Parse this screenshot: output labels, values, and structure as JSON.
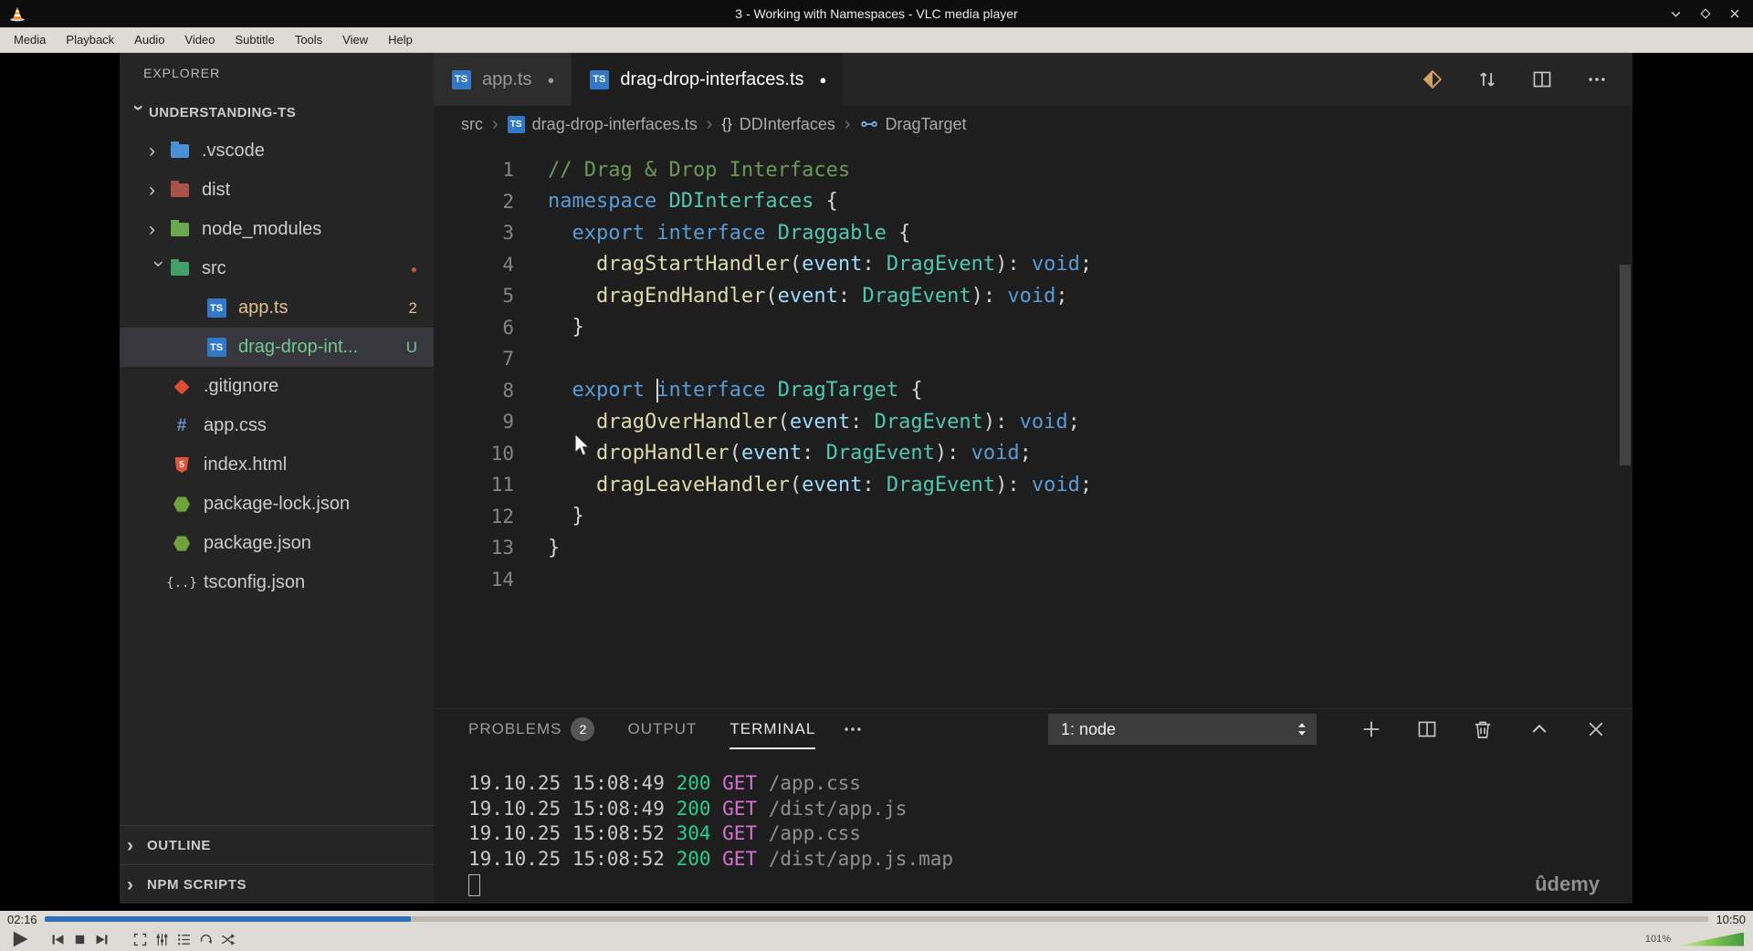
{
  "colors": {
    "accent_blue": "#2f6fb5",
    "keyword_blue": "#569cd6",
    "type_green": "#4ec9b0",
    "function_yellow": "#dcdcaa",
    "comment_green": "#6a9955",
    "param_blue": "#9cdcfe",
    "status_green": "#23d18b",
    "method_magenta": "#d670d6",
    "modified_tan": "#e2c08d",
    "untracked_green": "#73c991"
  },
  "vlc": {
    "window_title": "3 - Working with Namespaces - VLC media player",
    "menu_items": [
      "Media",
      "Playback",
      "Audio",
      "Video",
      "Subtitle",
      "Tools",
      "View",
      "Help"
    ],
    "seek": {
      "elapsed": "02:16",
      "remaining": "10:50",
      "progress_percent": 22
    },
    "volume_percent": "101%"
  },
  "vscode": {
    "explorer": {
      "title": "EXPLORER",
      "root_label": "UNDERSTANDING-TS",
      "tree": [
        {
          "label": ".vscode",
          "kind": "folder",
          "icon": "vscode-folder",
          "depth": 1,
          "chevron": "right"
        },
        {
          "label": "dist",
          "kind": "folder",
          "icon": "dist-folder",
          "depth": 1,
          "chevron": "right"
        },
        {
          "label": "node_modules",
          "kind": "folder",
          "icon": "node-folder",
          "depth": 1,
          "chevron": "right"
        },
        {
          "label": "src",
          "kind": "folder",
          "icon": "src-folder",
          "depth": 1,
          "chevron": "down",
          "badge": "dot"
        },
        {
          "label": "app.ts",
          "kind": "file",
          "icon": "ts",
          "depth": 2,
          "badge": "2",
          "color": "modified"
        },
        {
          "label": "drag-drop-int...",
          "kind": "file",
          "icon": "ts",
          "depth": 2,
          "badge": "U",
          "color": "untracked",
          "selected": true
        },
        {
          "label": ".gitignore",
          "kind": "file",
          "icon": "git",
          "depth": 1
        },
        {
          "label": "app.css",
          "kind": "file",
          "icon": "css",
          "depth": 1
        },
        {
          "label": "index.html",
          "kind": "file",
          "icon": "html",
          "depth": 1
        },
        {
          "label": "package-lock.json",
          "kind": "file",
          "icon": "npm",
          "depth": 1
        },
        {
          "label": "package.json",
          "kind": "file",
          "icon": "npm",
          "depth": 1
        },
        {
          "label": "tsconfig.json",
          "kind": "file",
          "icon": "json-config",
          "depth": 1
        }
      ],
      "bottom_sections": [
        "OUTLINE",
        "NPM SCRIPTS"
      ]
    },
    "editor_tabs": [
      {
        "label": "app.ts",
        "active": false,
        "modified": true
      },
      {
        "label": "drag-drop-interfaces.ts",
        "active": true,
        "modified": true
      }
    ],
    "breadcrumb": [
      {
        "label": "src",
        "icon": null
      },
      {
        "label": "drag-drop-interfaces.ts",
        "icon": "ts"
      },
      {
        "label": "DDInterfaces",
        "icon": "braces"
      },
      {
        "label": "DragTarget",
        "icon": "symbol"
      }
    ],
    "code_lines": [
      {
        "num": 1,
        "tokens": [
          {
            "c": "comment",
            "v": "// Drag & Drop Interfaces"
          }
        ]
      },
      {
        "num": 2,
        "tokens": [
          {
            "c": "kw",
            "v": "namespace"
          },
          {
            "c": "punct",
            "v": " "
          },
          {
            "c": "type",
            "v": "DDInterfaces"
          },
          {
            "c": "punct",
            "v": " {"
          }
        ]
      },
      {
        "num": 3,
        "tokens": [
          {
            "c": "punct",
            "v": "  "
          },
          {
            "c": "kw",
            "v": "export"
          },
          {
            "c": "punct",
            "v": " "
          },
          {
            "c": "kw",
            "v": "interface"
          },
          {
            "c": "punct",
            "v": " "
          },
          {
            "c": "type",
            "v": "Draggable"
          },
          {
            "c": "punct",
            "v": " {"
          }
        ]
      },
      {
        "num": 4,
        "tokens": [
          {
            "c": "punct",
            "v": "    "
          },
          {
            "c": "fn",
            "v": "dragStartHandler"
          },
          {
            "c": "punct",
            "v": "("
          },
          {
            "c": "param",
            "v": "event"
          },
          {
            "c": "punct",
            "v": ": "
          },
          {
            "c": "type",
            "v": "DragEvent"
          },
          {
            "c": "punct",
            "v": "): "
          },
          {
            "c": "kw",
            "v": "void"
          },
          {
            "c": "punct",
            "v": ";"
          }
        ]
      },
      {
        "num": 5,
        "tokens": [
          {
            "c": "punct",
            "v": "    "
          },
          {
            "c": "fn",
            "v": "dragEndHandler"
          },
          {
            "c": "punct",
            "v": "("
          },
          {
            "c": "param",
            "v": "event"
          },
          {
            "c": "punct",
            "v": ": "
          },
          {
            "c": "type",
            "v": "DragEvent"
          },
          {
            "c": "punct",
            "v": "): "
          },
          {
            "c": "kw",
            "v": "void"
          },
          {
            "c": "punct",
            "v": ";"
          }
        ]
      },
      {
        "num": 6,
        "tokens": [
          {
            "c": "punct",
            "v": "  }"
          }
        ]
      },
      {
        "num": 7,
        "tokens": []
      },
      {
        "num": 8,
        "tokens": [
          {
            "c": "punct",
            "v": "  "
          },
          {
            "c": "kw",
            "v": "export"
          },
          {
            "c": "punct",
            "v": " "
          },
          {
            "c": "caret",
            "v": ""
          },
          {
            "c": "kw",
            "v": "interface"
          },
          {
            "c": "punct",
            "v": " "
          },
          {
            "c": "type",
            "v": "DragTarget"
          },
          {
            "c": "punct",
            "v": " {"
          }
        ]
      },
      {
        "num": 9,
        "tokens": [
          {
            "c": "punct",
            "v": "    "
          },
          {
            "c": "fn",
            "v": "dragOverHandler"
          },
          {
            "c": "punct",
            "v": "("
          },
          {
            "c": "param",
            "v": "event"
          },
          {
            "c": "punct",
            "v": ": "
          },
          {
            "c": "type",
            "v": "DragEvent"
          },
          {
            "c": "punct",
            "v": "): "
          },
          {
            "c": "kw",
            "v": "void"
          },
          {
            "c": "punct",
            "v": ";"
          }
        ]
      },
      {
        "num": 10,
        "tokens": [
          {
            "c": "punct",
            "v": "    "
          },
          {
            "c": "fn",
            "v": "dropHandler"
          },
          {
            "c": "punct",
            "v": "("
          },
          {
            "c": "param",
            "v": "event"
          },
          {
            "c": "punct",
            "v": ": "
          },
          {
            "c": "type",
            "v": "DragEvent"
          },
          {
            "c": "punct",
            "v": "): "
          },
          {
            "c": "kw",
            "v": "void"
          },
          {
            "c": "punct",
            "v": ";"
          }
        ]
      },
      {
        "num": 11,
        "tokens": [
          {
            "c": "punct",
            "v": "    "
          },
          {
            "c": "fn",
            "v": "dragLeaveHandler"
          },
          {
            "c": "punct",
            "v": "("
          },
          {
            "c": "param",
            "v": "event"
          },
          {
            "c": "punct",
            "v": ": "
          },
          {
            "c": "type",
            "v": "DragEvent"
          },
          {
            "c": "punct",
            "v": "): "
          },
          {
            "c": "kw",
            "v": "void"
          },
          {
            "c": "punct",
            "v": ";"
          }
        ]
      },
      {
        "num": 12,
        "tokens": [
          {
            "c": "punct",
            "v": "  }"
          }
        ]
      },
      {
        "num": 13,
        "tokens": [
          {
            "c": "punct",
            "v": "}"
          }
        ]
      },
      {
        "num": 14,
        "tokens": []
      }
    ],
    "panel": {
      "tabs": [
        {
          "label": "PROBLEMS",
          "badge": "2",
          "active": false
        },
        {
          "label": "OUTPUT",
          "active": false
        },
        {
          "label": "TERMINAL",
          "active": true
        }
      ],
      "shell_selector": "1: node",
      "terminal_lines": [
        {
          "timestamp": "19.10.25 15:08:49",
          "status": "200",
          "method": "GET",
          "path": "/app.css"
        },
        {
          "timestamp": "19.10.25 15:08:49",
          "status": "200",
          "method": "GET",
          "path": "/dist/app.js"
        },
        {
          "timestamp": "19.10.25 15:08:52",
          "status": "304",
          "method": "GET",
          "path": "/app.css"
        },
        {
          "timestamp": "19.10.25 15:08:52",
          "status": "200",
          "method": "GET",
          "path": "/dist/app.js.map"
        }
      ],
      "watermark": "ûdemy"
    }
  }
}
